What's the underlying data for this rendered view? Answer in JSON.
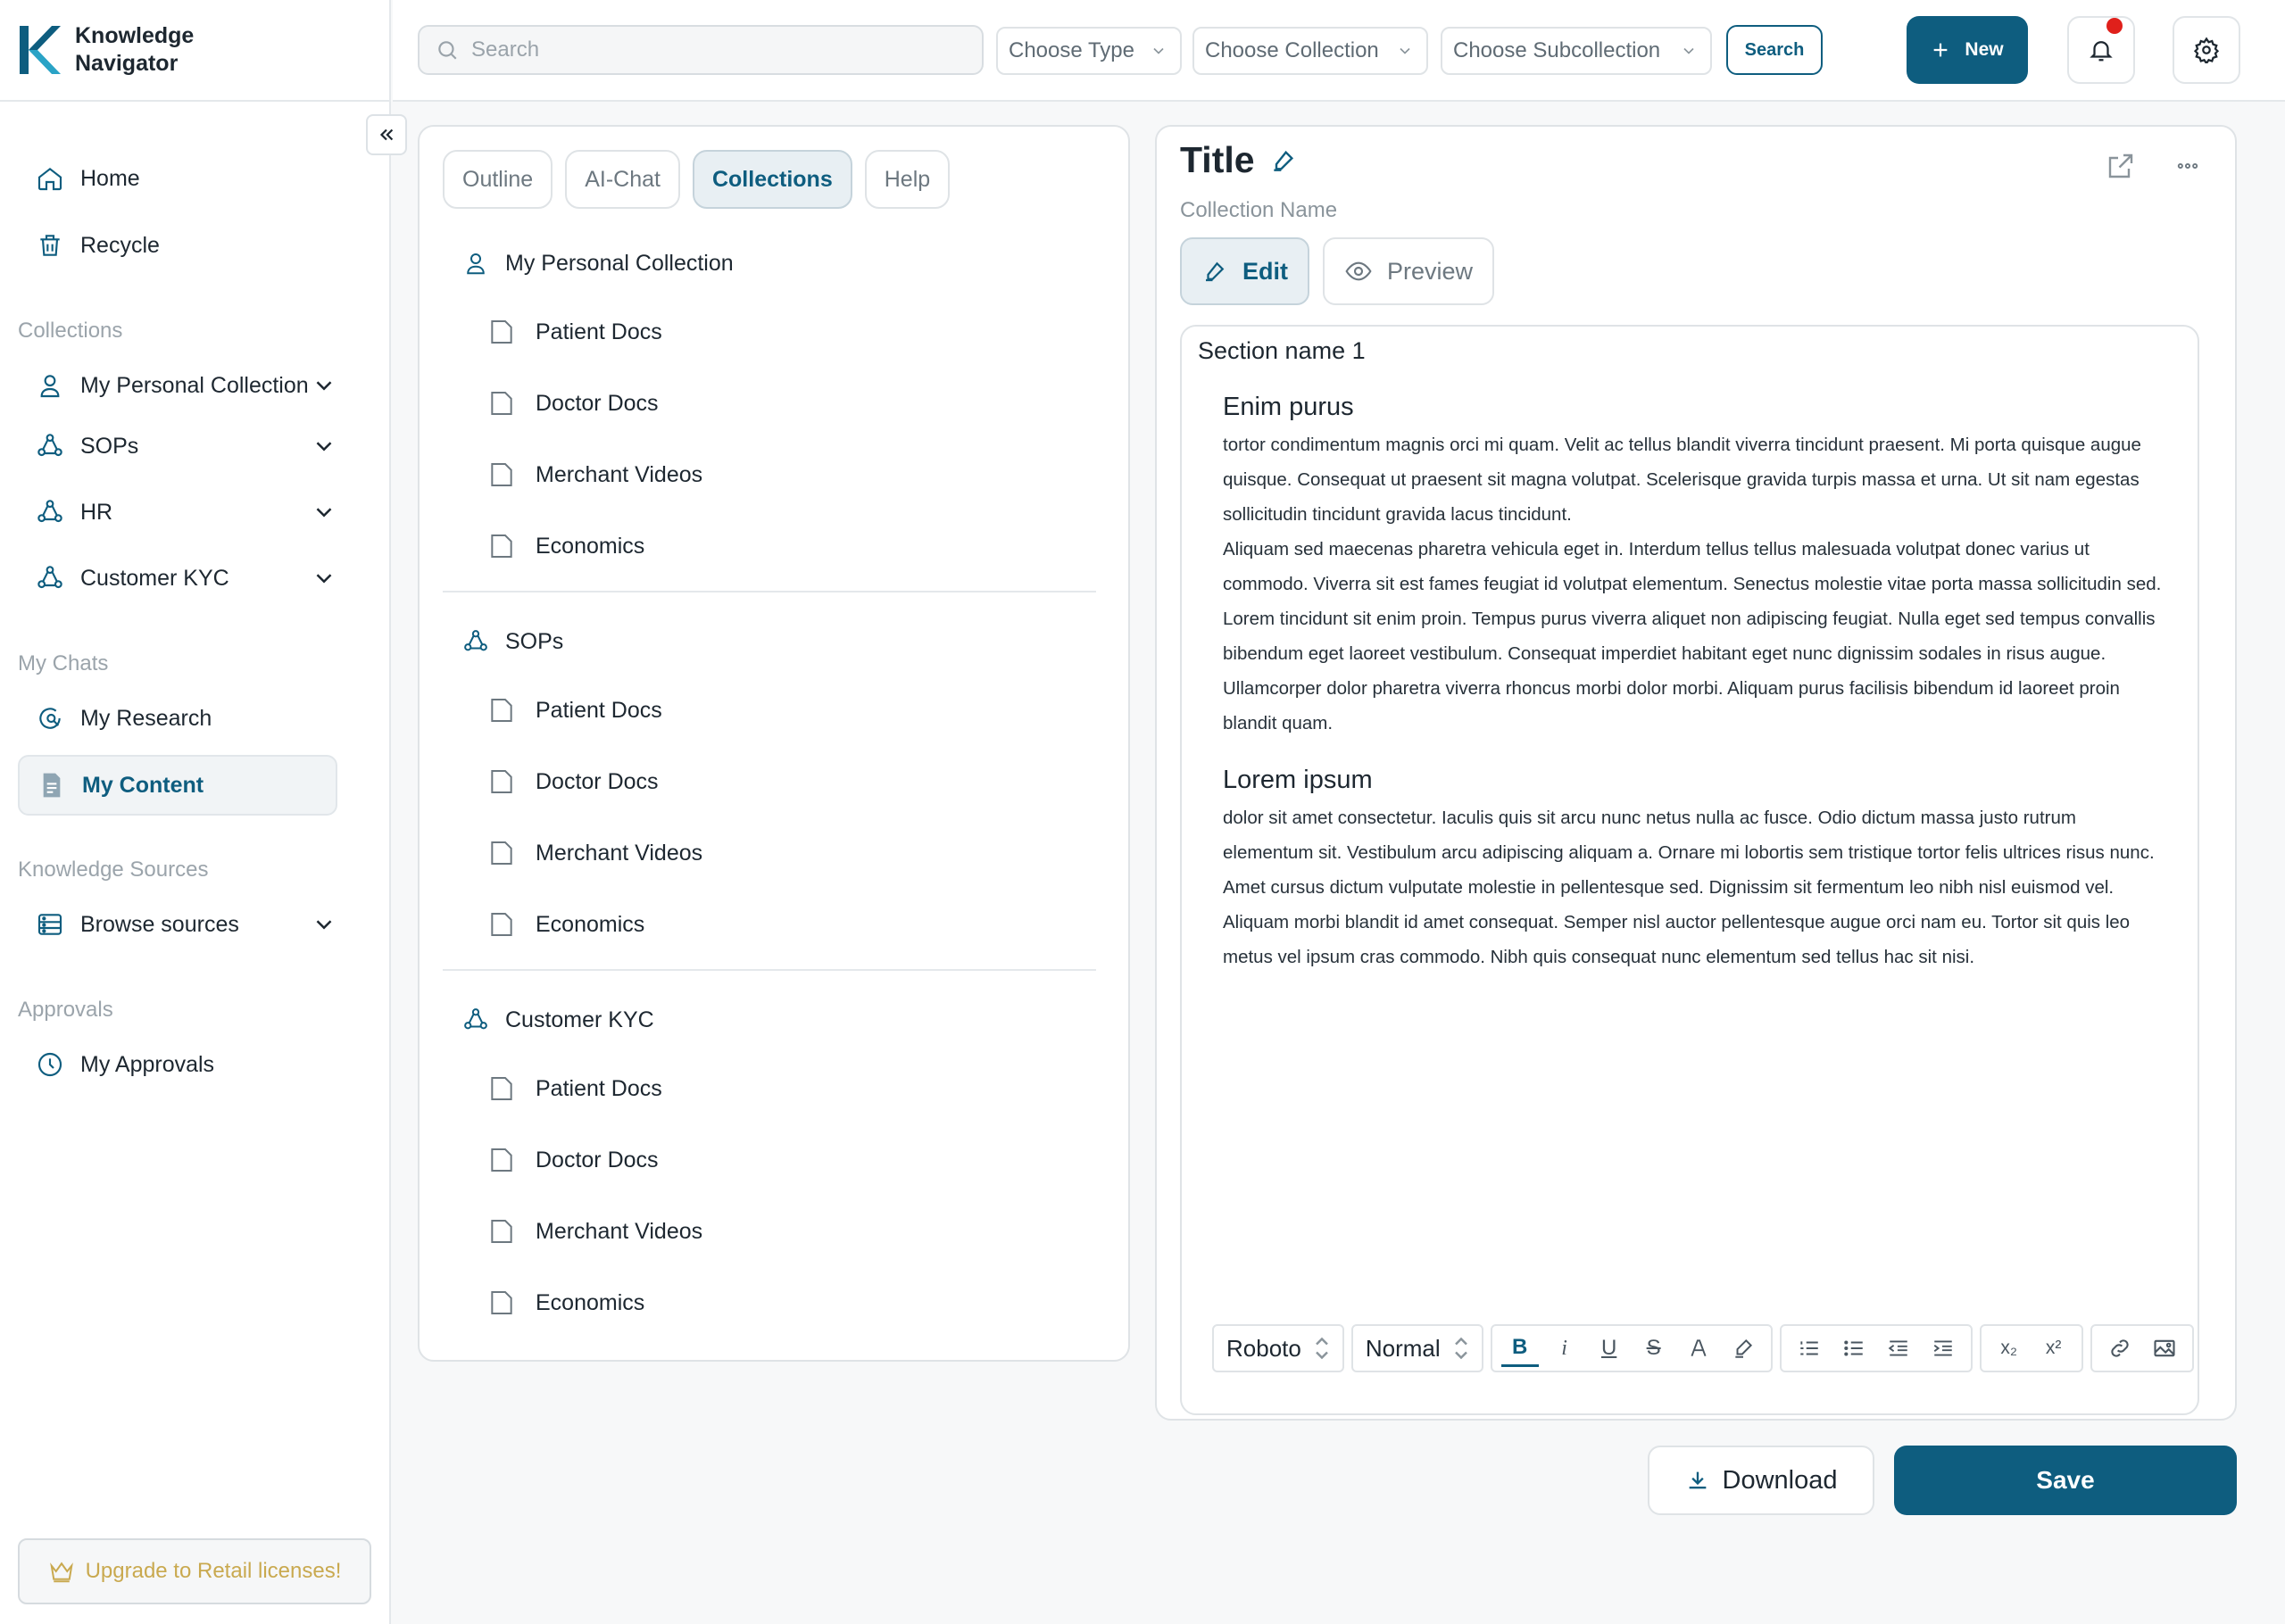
{
  "app": {
    "name_line1": "Knowledge",
    "name_line2": "Navigator"
  },
  "sidebar": {
    "nav": [
      {
        "label": "Home",
        "icon": "home-icon"
      },
      {
        "label": "Recycle",
        "icon": "trash-icon"
      }
    ],
    "collections_label": "Collections",
    "collections": [
      {
        "label": "My Personal Collection",
        "icon": "user-icon"
      },
      {
        "label": "SOPs",
        "icon": "group-icon"
      },
      {
        "label": "HR",
        "icon": "group-icon"
      },
      {
        "label": "Customer KYC",
        "icon": "group-icon"
      }
    ],
    "chats_label": "My Chats",
    "chats": [
      {
        "label": "My Research",
        "icon": "research-icon"
      },
      {
        "label": "My Content",
        "icon": "document-icon",
        "active": true
      }
    ],
    "sources_label": "Knowledge Sources",
    "sources": [
      {
        "label": "Browse sources",
        "icon": "sources-icon"
      }
    ],
    "approvals_label": "Approvals",
    "approvals": [
      {
        "label": "My Approvals",
        "icon": "clock-icon"
      }
    ],
    "upgrade_label": "Upgrade to Retail licenses!"
  },
  "topbar": {
    "search_placeholder": "Search",
    "type_dropdown": "Choose Type",
    "collection_dropdown": "Choose Collection",
    "subcollection_dropdown": "Choose Subcollection",
    "search_button": "Search",
    "new_button": "New"
  },
  "collections_panel": {
    "tabs": [
      "Outline",
      "AI-Chat",
      "Collections",
      "Help"
    ],
    "active_tab": "Collections",
    "groups": [
      {
        "name": "My Personal Collection",
        "icon": "user-icon",
        "items": [
          "Patient Docs",
          "Doctor Docs",
          "Merchant Videos",
          "Economics"
        ]
      },
      {
        "name": "SOPs",
        "icon": "group-icon",
        "items": [
          "Patient Docs",
          "Doctor Docs",
          "Merchant Videos",
          "Economics"
        ]
      },
      {
        "name": "Customer KYC",
        "icon": "group-icon",
        "items": [
          "Patient Docs",
          "Doctor Docs",
          "Merchant Videos",
          "Economics"
        ]
      }
    ]
  },
  "editor": {
    "title": "Title",
    "collection_name": "Collection Name",
    "edit_label": "Edit",
    "preview_label": "Preview",
    "section_name": "Section name 1",
    "blocks": [
      {
        "heading": "Enim purus",
        "paragraphs": [
          "tortor condimentum magnis orci mi quam. Velit ac tellus blandit viverra tincidunt praesent. Mi porta quisque augue quisque. Consequat ut praesent sit magna volutpat. Scelerisque gravida turpis massa et urna. Ut sit nam egestas sollicitudin tincidunt gravida lacus tincidunt.",
          "Aliquam sed maecenas pharetra vehicula eget in. Interdum tellus tellus malesuada volutpat donec varius ut commodo. Viverra sit est fames feugiat id volutpat elementum. Senectus molestie vitae porta massa sollicitudin sed. Lorem tincidunt sit enim proin. Tempus purus viverra aliquet non adipiscing feugiat. Nulla eget sed tempus convallis bibendum eget laoreet vestibulum. Consequat imperdiet habitant eget nunc dignissim sodales in risus augue. Ullamcorper dolor pharetra viverra rhoncus morbi dolor morbi. Aliquam purus facilisis bibendum id laoreet proin blandit quam."
        ]
      },
      {
        "heading": "Lorem ipsum",
        "paragraphs": [
          "dolor sit amet consectetur. Iaculis quis sit arcu nunc netus nulla ac fusce. Odio dictum massa justo rutrum elementum sit. Vestibulum arcu adipiscing aliquam a. Ornare mi lobortis sem tristique tortor felis ultrices risus nunc.",
          "Amet cursus dictum vulputate molestie in pellentesque sed. Dignissim sit fermentum leo nibh nisl euismod vel. Aliquam morbi blandit id amet consequat. Semper nisl auctor pellentesque augue orci nam eu. Tortor sit quis leo metus vel ipsum cras commodo. Nibh quis consequat nunc elementum sed tellus hac sit nisi."
        ]
      }
    ],
    "toolbar": {
      "font": "Roboto",
      "style": "Normal",
      "buttons": [
        "B",
        "i",
        "U",
        "S"
      ],
      "subscript": "x₂",
      "superscript": "x²"
    },
    "download_label": "Download",
    "save_label": "Save"
  },
  "colors": {
    "primary": "#0e5d7f",
    "notification": "#e0201b",
    "upgrade_gold": "#c9a94f"
  }
}
